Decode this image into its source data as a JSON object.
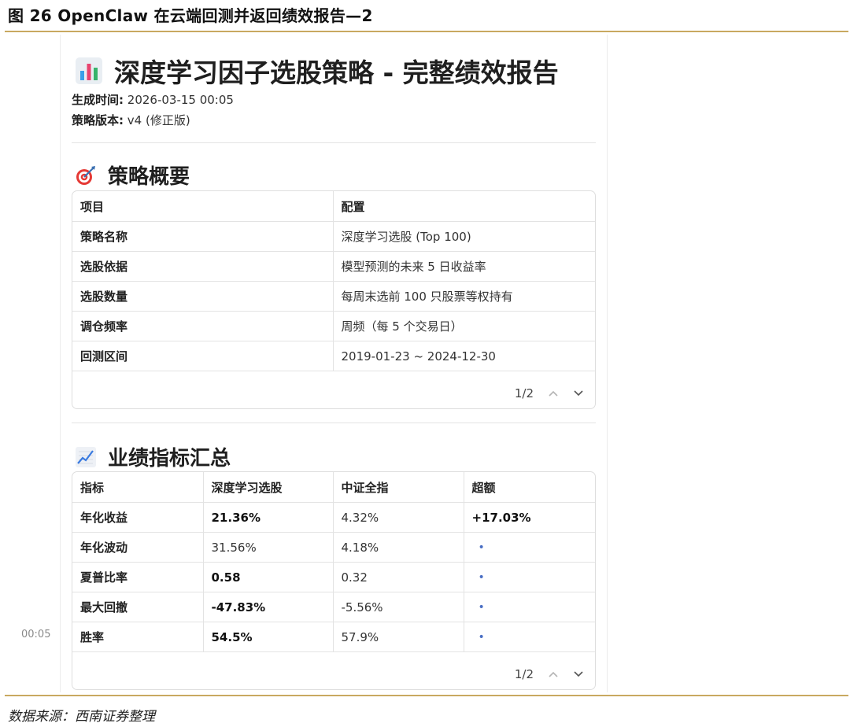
{
  "figure": {
    "title": "图 26 OpenClaw 在云端回测并返回绩效报告—2",
    "source": "数据来源：西南证券整理"
  },
  "screenshot": {
    "side_time": "00:05",
    "report": {
      "title": "深度学习因子选股策略 - 完整绩效报告",
      "title_icon": "bar-chart-icon",
      "generated_label": "生成时间:",
      "generated_value": "2026-03-15 00:05",
      "version_label": "策略版本:",
      "version_value": "v4 (修正版)"
    },
    "summary": {
      "heading": "策略概要",
      "heading_icon": "target-icon",
      "columns": [
        "项目",
        "配置"
      ],
      "rows": [
        [
          "策略名称",
          "深度学习选股 (Top 100)"
        ],
        [
          "选股依据",
          "模型预测的未来 5 日收益率"
        ],
        [
          "选股数量",
          "每周末选前 100 只股票等权持有"
        ],
        [
          "调仓频率",
          "周频（每 5 个交易日）"
        ],
        [
          "回测区间",
          "2019-01-23 ~ 2024-12-30"
        ]
      ],
      "pager": "1/2"
    },
    "metrics": {
      "heading": "业绩指标汇总",
      "heading_icon": "trend-chart-icon",
      "columns": [
        "指标",
        "深度学习选股",
        "中证全指",
        "超额"
      ],
      "rows": [
        [
          "年化收益",
          "21.36%",
          "4.32%",
          "+17.03%"
        ],
        [
          "年化波动",
          "31.56%",
          "4.18%",
          "•"
        ],
        [
          "夏普比率",
          "0.58",
          "0.32",
          "•"
        ],
        [
          "最大回撤",
          "-47.83%",
          "-5.56%",
          "•"
        ],
        [
          "胜率",
          "54.5%",
          "57.9%",
          "•"
        ]
      ],
      "pager": "1/2"
    },
    "colors": {
      "accent_rule": "#c9a961",
      "dot_blue": "#4a6fc4"
    }
  }
}
